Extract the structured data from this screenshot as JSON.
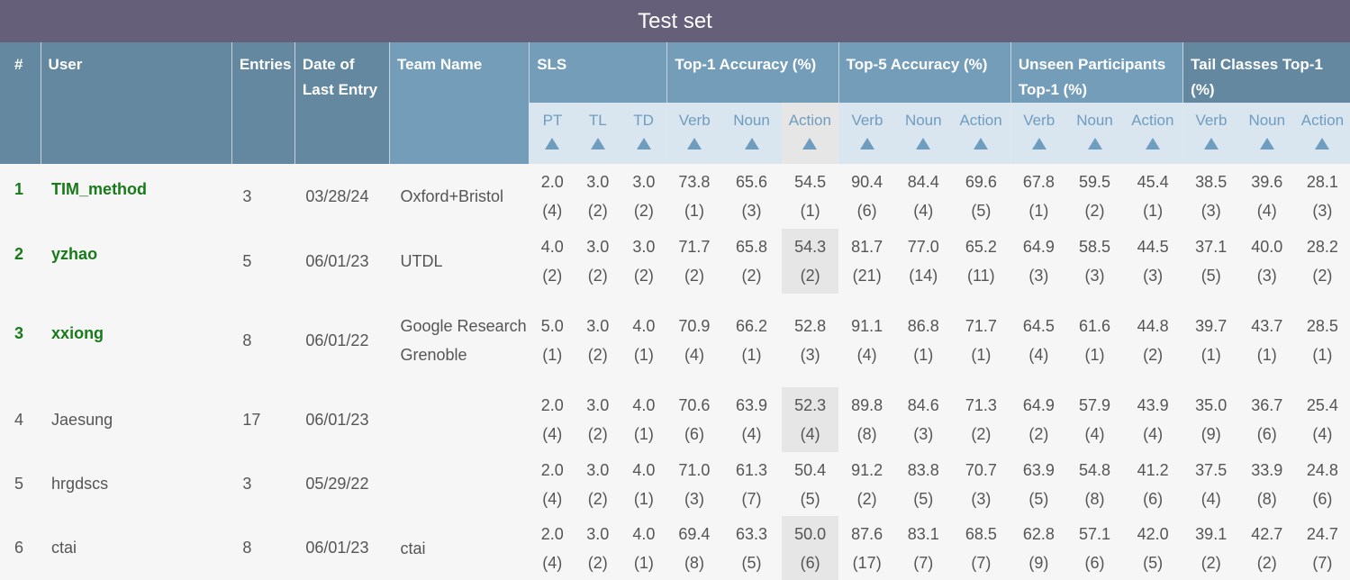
{
  "title": "Test set",
  "headers": {
    "rank": "#",
    "user": "User",
    "entries": "Entries",
    "date": "Date of Last Entry",
    "team": "Team Name",
    "groups": [
      {
        "label": "SLS",
        "cols": [
          "PT",
          "TL",
          "TD"
        ]
      },
      {
        "label": "Top-1 Accuracy (%)",
        "cols": [
          "Verb",
          "Noun",
          "Action"
        ]
      },
      {
        "label": "Top-5 Accuracy (%)",
        "cols": [
          "Verb",
          "Noun",
          "Action"
        ]
      },
      {
        "label": "Unseen Participants Top-1 (%)",
        "cols": [
          "Verb",
          "Noun",
          "Action"
        ]
      },
      {
        "label": "Tail Classes Top-1 (%)",
        "cols": [
          "Verb",
          "Noun",
          "Action"
        ]
      }
    ]
  },
  "rows": [
    {
      "rank": "1",
      "user": "TIM_method",
      "entries": "3",
      "date": "03/28/24",
      "team": "Oxford+Bristol",
      "metrics": [
        [
          "2.0",
          "(4)"
        ],
        [
          "3.0",
          "(2)"
        ],
        [
          "3.0",
          "(2)"
        ],
        [
          "73.8",
          "(1)"
        ],
        [
          "65.6",
          "(3)"
        ],
        [
          "54.5",
          "(1)"
        ],
        [
          "90.4",
          "(6)"
        ],
        [
          "84.4",
          "(4)"
        ],
        [
          "69.6",
          "(5)"
        ],
        [
          "67.8",
          "(1)"
        ],
        [
          "59.5",
          "(2)"
        ],
        [
          "45.4",
          "(1)"
        ],
        [
          "38.5",
          "(3)"
        ],
        [
          "39.6",
          "(4)"
        ],
        [
          "28.1",
          "(3)"
        ]
      ]
    },
    {
      "rank": "2",
      "user": "yzhao",
      "entries": "5",
      "date": "06/01/23",
      "team": "UTDL",
      "metrics": [
        [
          "4.0",
          "(2)"
        ],
        [
          "3.0",
          "(2)"
        ],
        [
          "3.0",
          "(2)"
        ],
        [
          "71.7",
          "(2)"
        ],
        [
          "65.8",
          "(2)"
        ],
        [
          "54.3",
          "(2)"
        ],
        [
          "81.7",
          "(21)"
        ],
        [
          "77.0",
          "(14)"
        ],
        [
          "65.2",
          "(11)"
        ],
        [
          "64.9",
          "(3)"
        ],
        [
          "58.5",
          "(3)"
        ],
        [
          "44.5",
          "(3)"
        ],
        [
          "37.1",
          "(5)"
        ],
        [
          "40.0",
          "(3)"
        ],
        [
          "28.2",
          "(2)"
        ]
      ]
    },
    {
      "rank": "3",
      "user": "xxiong",
      "entries": "8",
      "date": "06/01/22",
      "team": "Google Research Grenoble",
      "metrics": [
        [
          "5.0",
          "(1)"
        ],
        [
          "3.0",
          "(2)"
        ],
        [
          "4.0",
          "(1)"
        ],
        [
          "70.9",
          "(4)"
        ],
        [
          "66.2",
          "(1)"
        ],
        [
          "52.8",
          "(3)"
        ],
        [
          "91.1",
          "(4)"
        ],
        [
          "86.8",
          "(1)"
        ],
        [
          "71.7",
          "(1)"
        ],
        [
          "64.5",
          "(4)"
        ],
        [
          "61.6",
          "(1)"
        ],
        [
          "44.8",
          "(2)"
        ],
        [
          "39.7",
          "(1)"
        ],
        [
          "43.7",
          "(1)"
        ],
        [
          "28.5",
          "(1)"
        ]
      ]
    },
    {
      "rank": "4",
      "user": "Jaesung",
      "entries": "17",
      "date": "06/01/23",
      "team": "",
      "metrics": [
        [
          "2.0",
          "(4)"
        ],
        [
          "3.0",
          "(2)"
        ],
        [
          "4.0",
          "(1)"
        ],
        [
          "70.6",
          "(6)"
        ],
        [
          "63.9",
          "(4)"
        ],
        [
          "52.3",
          "(4)"
        ],
        [
          "89.8",
          "(8)"
        ],
        [
          "84.6",
          "(3)"
        ],
        [
          "71.3",
          "(2)"
        ],
        [
          "64.9",
          "(2)"
        ],
        [
          "57.9",
          "(4)"
        ],
        [
          "43.9",
          "(4)"
        ],
        [
          "35.0",
          "(9)"
        ],
        [
          "36.7",
          "(6)"
        ],
        [
          "25.4",
          "(4)"
        ]
      ]
    },
    {
      "rank": "5",
      "user": "hrgdscs",
      "entries": "3",
      "date": "05/29/22",
      "team": "",
      "metrics": [
        [
          "2.0",
          "(4)"
        ],
        [
          "3.0",
          "(2)"
        ],
        [
          "4.0",
          "(1)"
        ],
        [
          "71.0",
          "(3)"
        ],
        [
          "61.3",
          "(7)"
        ],
        [
          "50.4",
          "(5)"
        ],
        [
          "91.2",
          "(2)"
        ],
        [
          "83.8",
          "(5)"
        ],
        [
          "70.7",
          "(3)"
        ],
        [
          "63.9",
          "(5)"
        ],
        [
          "54.8",
          "(8)"
        ],
        [
          "41.2",
          "(6)"
        ],
        [
          "37.5",
          "(4)"
        ],
        [
          "33.9",
          "(8)"
        ],
        [
          "24.8",
          "(6)"
        ]
      ]
    },
    {
      "rank": "6",
      "user": "ctai",
      "entries": "8",
      "date": "06/01/23",
      "team": "ctai",
      "metrics": [
        [
          "2.0",
          "(4)"
        ],
        [
          "3.0",
          "(2)"
        ],
        [
          "4.0",
          "(1)"
        ],
        [
          "69.4",
          "(8)"
        ],
        [
          "63.3",
          "(5)"
        ],
        [
          "50.0",
          "(6)"
        ],
        [
          "87.6",
          "(17)"
        ],
        [
          "83.1",
          "(7)"
        ],
        [
          "68.5",
          "(7)"
        ],
        [
          "62.8",
          "(9)"
        ],
        [
          "57.1",
          "(6)"
        ],
        [
          "42.0",
          "(5)"
        ],
        [
          "39.1",
          "(2)"
        ],
        [
          "42.7",
          "(2)"
        ],
        [
          "24.7",
          "(7)"
        ]
      ]
    }
  ]
}
